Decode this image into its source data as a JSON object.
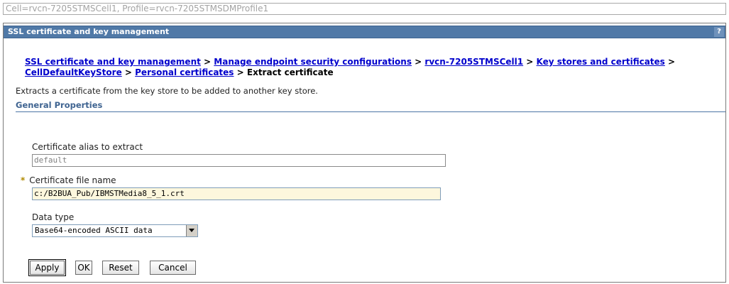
{
  "scope": {
    "text": "Cell=rvcn-7205STMSCell1, Profile=rvcn-7205STMSDMProfile1"
  },
  "panel": {
    "title": "SSL certificate and key management",
    "help_label": "?"
  },
  "breadcrumb": {
    "items": [
      "SSL certificate and key management",
      "Manage endpoint security configurations",
      "rvcn-7205STMSCell1",
      "Key stores and certificates",
      "CellDefaultKeyStore",
      "Personal certificates"
    ],
    "separator": " > ",
    "current": "Extract certificate"
  },
  "description": "Extracts a certificate from the key store to be added to another key store.",
  "section": {
    "title": "General Properties"
  },
  "form": {
    "alias": {
      "label": "Certificate alias to extract",
      "value": "default"
    },
    "filename": {
      "required_marker": "*",
      "label": "Certificate file name",
      "value": "c:/B2BUA_Pub/IBMSTMedia8_5_1.crt"
    },
    "data_type": {
      "label": "Data type",
      "selected": "Base64-encoded ASCII data"
    }
  },
  "buttons": {
    "apply": "Apply",
    "ok": "OK",
    "reset": "Reset",
    "cancel": "Cancel"
  },
  "colors": {
    "title_bar": "#5079a7",
    "link": "#0000cc",
    "section_heading": "#3f6491",
    "required_marker": "#b08a00",
    "required_field_bg": "#fdf7dd"
  }
}
